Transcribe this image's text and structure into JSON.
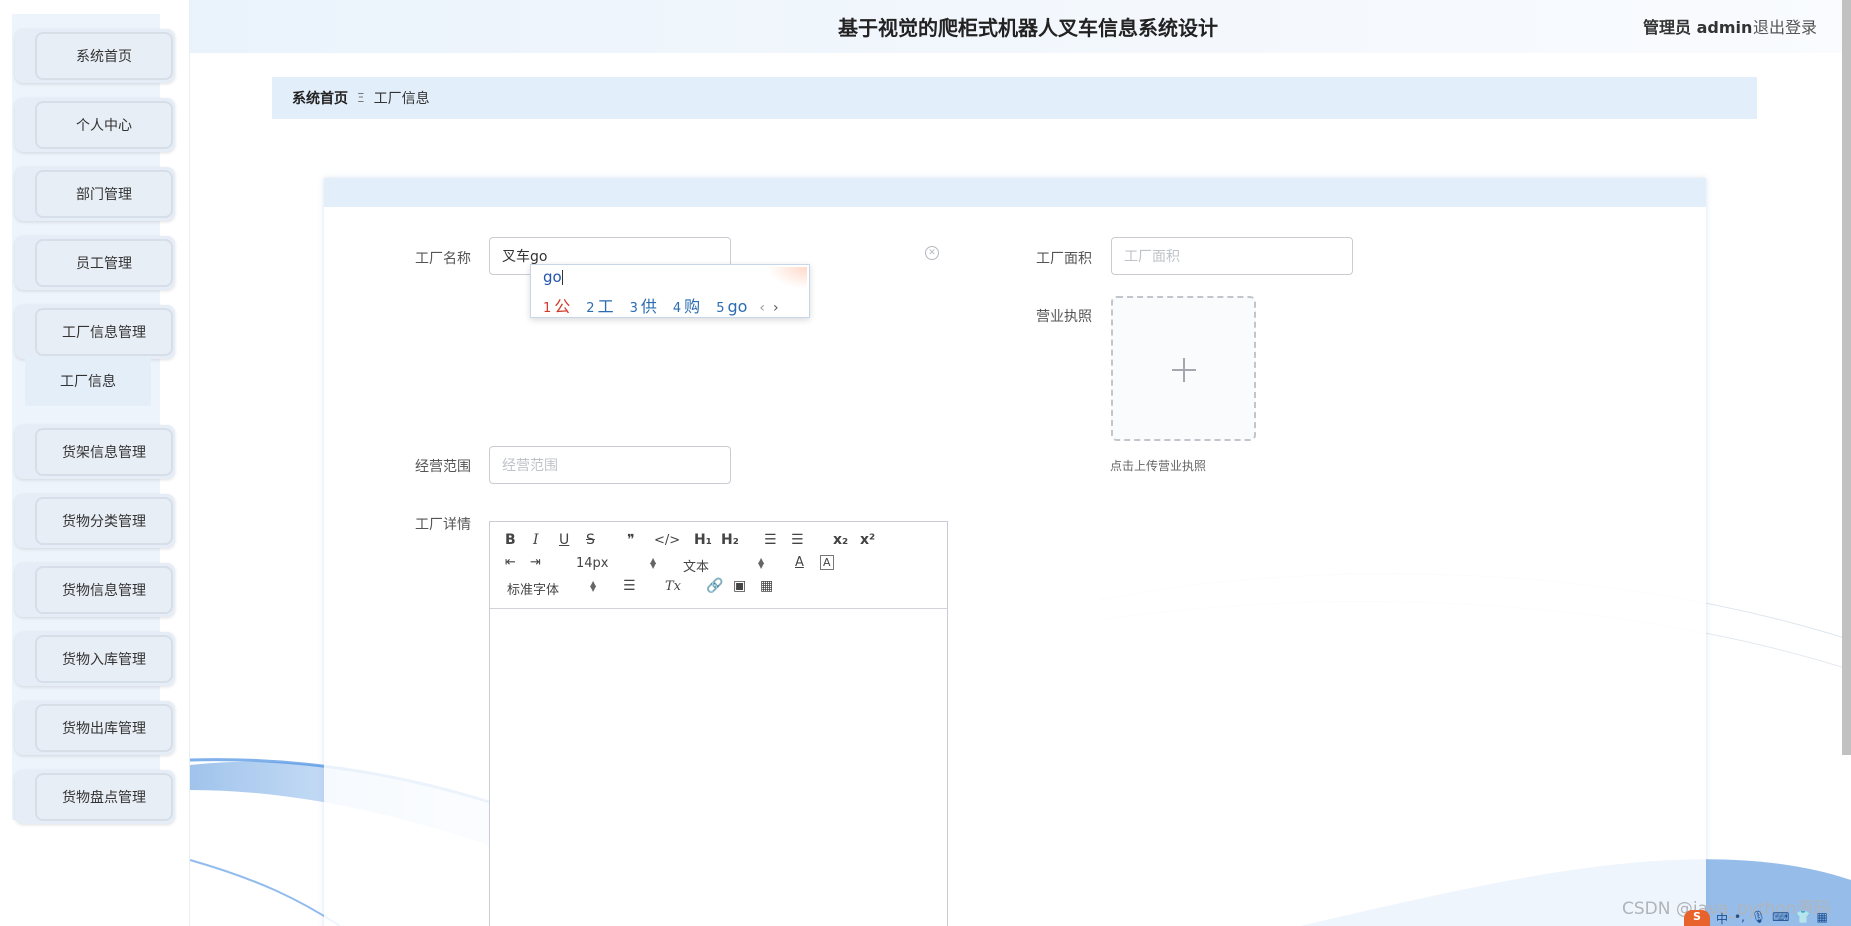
{
  "header": {
    "title": "基于视觉的爬柜式机器人叉车信息系统设计",
    "user": "管理员 admin",
    "logout": "退出登录"
  },
  "sidebar": {
    "items": [
      {
        "label": "系统首页"
      },
      {
        "label": "个人中心"
      },
      {
        "label": "部门管理"
      },
      {
        "label": "员工管理"
      },
      {
        "label": "工厂信息管理"
      },
      {
        "label": "货架信息管理"
      },
      {
        "label": "货物分类管理"
      },
      {
        "label": "货物信息管理"
      },
      {
        "label": "货物入库管理"
      },
      {
        "label": "货物出库管理"
      },
      {
        "label": "货物盘点管理"
      }
    ],
    "active_sub": "工厂信息"
  },
  "breadcrumb": {
    "home": "系统首页",
    "separator": "Ξ",
    "current": "工厂信息"
  },
  "form": {
    "factory_name_label": "工厂名称",
    "factory_name_value": "叉车go",
    "factory_area_label": "工厂面积",
    "factory_area_placeholder": "工厂面积",
    "license_label": "营业执照",
    "license_hint": "点击上传营业执照",
    "scope_label": "经营范围",
    "scope_placeholder": "经营范围",
    "details_label": "工厂详情"
  },
  "ime": {
    "typed": "go",
    "candidates": [
      {
        "n": "1",
        "text": "公"
      },
      {
        "n": "2",
        "text": "工"
      },
      {
        "n": "3",
        "text": "供"
      },
      {
        "n": "4",
        "text": "购"
      },
      {
        "n": "5",
        "text": "go"
      }
    ],
    "prev": "‹",
    "next": "›"
  },
  "editor": {
    "bold": "B",
    "italic": "I",
    "underline": "U",
    "strike": "S",
    "quote": "❞",
    "code": "</>",
    "h1": "H₁",
    "h2": "H₂",
    "ol": "☰",
    "ul": "☰",
    "sub": "x₂",
    "sup": "x²",
    "size": "14px",
    "block": "文本",
    "font": "标准字体",
    "color": "A",
    "bg": "A",
    "clean": "Tx"
  },
  "watermark": "CSDN @java_python源码",
  "colors": {
    "accent": "#e3eefb",
    "sidebar_item": "#e8eef5",
    "wave": "#5b9de0"
  }
}
